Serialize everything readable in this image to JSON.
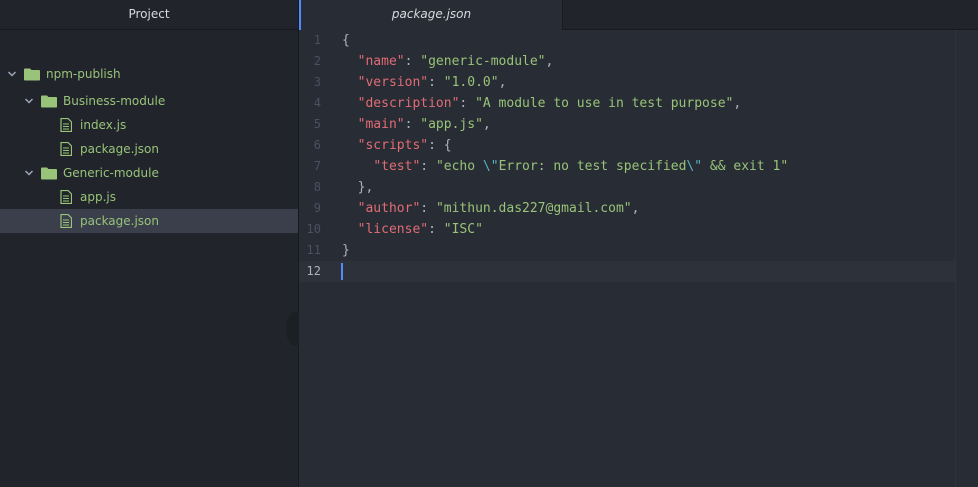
{
  "sidebar": {
    "title": "Project",
    "tree": [
      {
        "label": "npm-publish",
        "type": "dir",
        "depth": 0,
        "expanded": true,
        "selected": false
      },
      {
        "label": "Business-module",
        "type": "dir",
        "depth": 1,
        "expanded": true,
        "selected": false
      },
      {
        "label": "index.js",
        "type": "file",
        "depth": 2,
        "selected": false
      },
      {
        "label": "package.json",
        "type": "file",
        "depth": 2,
        "selected": false
      },
      {
        "label": "Generic-module",
        "type": "dir",
        "depth": 1,
        "expanded": true,
        "selected": false
      },
      {
        "label": "app.js",
        "type": "file",
        "depth": 2,
        "selected": false
      },
      {
        "label": "package.json",
        "type": "file",
        "depth": 2,
        "selected": true
      }
    ]
  },
  "tabs": [
    {
      "label": "package.json",
      "active": true
    }
  ],
  "editor": {
    "cursor_line": 12,
    "lines": [
      {
        "n": "1",
        "tokens": [
          [
            "p",
            "{"
          ]
        ]
      },
      {
        "n": "2",
        "tokens": [
          [
            "p",
            "  "
          ],
          [
            "k",
            "\"name\""
          ],
          [
            "p",
            ": "
          ],
          [
            "s",
            "\"generic-module\""
          ],
          [
            "p",
            ","
          ]
        ]
      },
      {
        "n": "3",
        "tokens": [
          [
            "p",
            "  "
          ],
          [
            "k",
            "\"version\""
          ],
          [
            "p",
            ": "
          ],
          [
            "s",
            "\"1.0.0\""
          ],
          [
            "p",
            ","
          ]
        ]
      },
      {
        "n": "4",
        "tokens": [
          [
            "p",
            "  "
          ],
          [
            "k",
            "\"description\""
          ],
          [
            "p",
            ": "
          ],
          [
            "s",
            "\"A module to use in test purpose\""
          ],
          [
            "p",
            ","
          ]
        ]
      },
      {
        "n": "5",
        "tokens": [
          [
            "p",
            "  "
          ],
          [
            "k",
            "\"main\""
          ],
          [
            "p",
            ": "
          ],
          [
            "s",
            "\"app.js\""
          ],
          [
            "p",
            ","
          ]
        ]
      },
      {
        "n": "6",
        "tokens": [
          [
            "p",
            "  "
          ],
          [
            "k",
            "\"scripts\""
          ],
          [
            "p",
            ": {"
          ]
        ]
      },
      {
        "n": "7",
        "tokens": [
          [
            "p",
            "    "
          ],
          [
            "k",
            "\"test\""
          ],
          [
            "p",
            ": "
          ],
          [
            "s",
            "\"echo "
          ],
          [
            "e",
            "\\\""
          ],
          [
            "s",
            "Error: no test specified"
          ],
          [
            "e",
            "\\\""
          ],
          [
            "s",
            " && exit 1\""
          ]
        ]
      },
      {
        "n": "8",
        "tokens": [
          [
            "p",
            "  },"
          ]
        ]
      },
      {
        "n": "9",
        "tokens": [
          [
            "p",
            "  "
          ],
          [
            "k",
            "\"author\""
          ],
          [
            "p",
            ": "
          ],
          [
            "s",
            "\"mithun.das227@gmail.com\""
          ],
          [
            "p",
            ","
          ]
        ]
      },
      {
        "n": "10",
        "tokens": [
          [
            "p",
            "  "
          ],
          [
            "k",
            "\"license\""
          ],
          [
            "p",
            ": "
          ],
          [
            "s",
            "\"ISC\""
          ]
        ]
      },
      {
        "n": "11",
        "tokens": [
          [
            "p",
            "}"
          ]
        ]
      },
      {
        "n": "12",
        "tokens": []
      }
    ]
  },
  "colors": {
    "accent": "#528bff",
    "key": "#e06c75",
    "string": "#98c379",
    "escape": "#56b6c2",
    "folder": "#98c379",
    "file": "#98c379"
  },
  "icons": [
    "chevron-down-icon",
    "folder-icon",
    "file-text-icon"
  ]
}
